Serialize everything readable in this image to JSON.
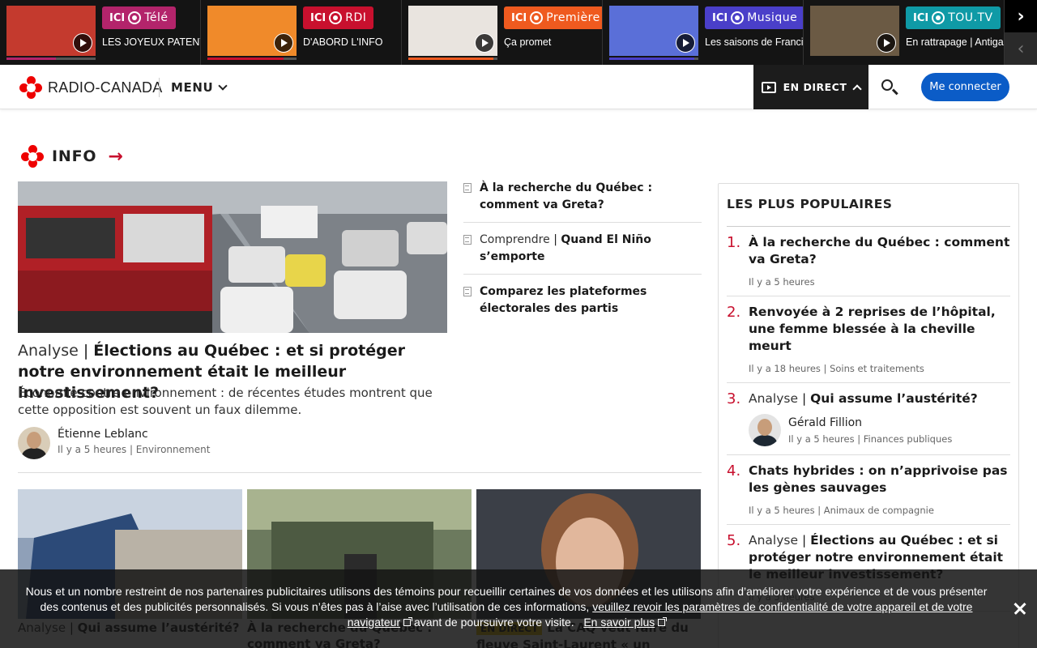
{
  "live_strip": {
    "items": [
      {
        "channel": "ICI",
        "brand": "Télé",
        "title": "LES JOYEUX PATENTEUX",
        "badge_color": "#b3246b",
        "progress": 0.55
      },
      {
        "channel": "ICI",
        "brand": "RDI",
        "title": "D'ABORD L'INFO",
        "badge_color": "#c8102e",
        "progress": 0.85
      },
      {
        "channel": "ICI",
        "brand": "Première",
        "title": "Ça promet",
        "badge_color": "#ef5a1f",
        "progress": 0.95
      },
      {
        "channel": "ICI",
        "brand": "Musique",
        "title": "Les saisons de Francis",
        "badge_color": "#4a3fc9",
        "progress": 0.95
      },
      {
        "channel": "ICI",
        "brand": "TOU.TV",
        "title": "En rattrapage | Antigang",
        "badge_color": "#0f9aa6",
        "progress": 0
      }
    ]
  },
  "header": {
    "logo_text": "RADIO-CANADA",
    "menu_label": "MENU",
    "live_label": "EN DIRECT",
    "login_label": "Me connecter"
  },
  "section": {
    "title": "INFO"
  },
  "hero": {
    "kicker": "Analyse",
    "title": "Élections au Québec : et si protéger notre environnement était le meilleur investissement?",
    "description": "Économie contre environnement : de récentes études montrent que cette opposition est souvent un faux dilemme.",
    "author": "Étienne Leblanc",
    "time": "Il y a 5 heures",
    "category": "Environnement"
  },
  "side_links": [
    {
      "kicker": "",
      "title": "À la recherche du Québec : comment va Greta?"
    },
    {
      "kicker": "Comprendre",
      "title": "Quand El Niño s’emporte"
    },
    {
      "kicker": "",
      "title": "Comparez les plateformes électorales des partis"
    }
  ],
  "cards": [
    {
      "tag": "",
      "kicker": "Analyse",
      "title": "Qui assume l’austérité?"
    },
    {
      "tag": "",
      "kicker": "",
      "title": "À la recherche du Québec : comment va Greta?"
    },
    {
      "tag": "EN DIRECT",
      "kicker": "",
      "title": "La CAQ veut faire du fleuve Saint-Laurent « un"
    }
  ],
  "popular": {
    "title": "LES PLUS POPULAIRES",
    "items": [
      {
        "num": "1.",
        "kicker": "",
        "title": "À la recherche du Québec : comment va Greta?",
        "time": "Il y a 5 heures",
        "category": "",
        "author": ""
      },
      {
        "num": "2.",
        "kicker": "",
        "title": "Renvoyée à 2 reprises de l’hôpital, une femme blessée à la cheville meurt",
        "time": "Il y a 18 heures",
        "category": "Soins et traitements",
        "author": ""
      },
      {
        "num": "3.",
        "kicker": "Analyse",
        "title": "Qui assume l’austérité?",
        "time": "Il y a 5 heures",
        "category": "Finances publiques",
        "author": "Gérald Fillion"
      },
      {
        "num": "4.",
        "kicker": "",
        "title": "Chats hybrides : on n’apprivoise pas les gènes sauvages",
        "time": "Il y a 5 heures",
        "category": "Animaux de compagnie",
        "author": ""
      },
      {
        "num": "5.",
        "kicker": "Analyse",
        "title": "Élections au Québec : et si protéger notre environnement était le meilleur investissement?",
        "time": "Il y a 5 heures",
        "category": "",
        "author": ""
      }
    ]
  },
  "cookie": {
    "text": "Nous et un nombre restreint de nos partenaires publicitaires utilisons des témoins pour recueillir certaines de vos données et les utilisons afin d’améliorer votre expérience et de vous présenter des contenus et des publicités personnalisés. Si vous n’êtes pas à l’aise avec l’utilisation de ces informations,",
    "link_privacy": "veuillez revoir les paramètres de confidentialité de votre appareil et de votre navigateur",
    "text_after": "avant de poursuivre votre visite.",
    "link_more": "En savoir plus"
  },
  "colors": {
    "brand_red": "#e00000",
    "accent_red": "#c8102e",
    "login_blue": "#0b5cc7"
  }
}
